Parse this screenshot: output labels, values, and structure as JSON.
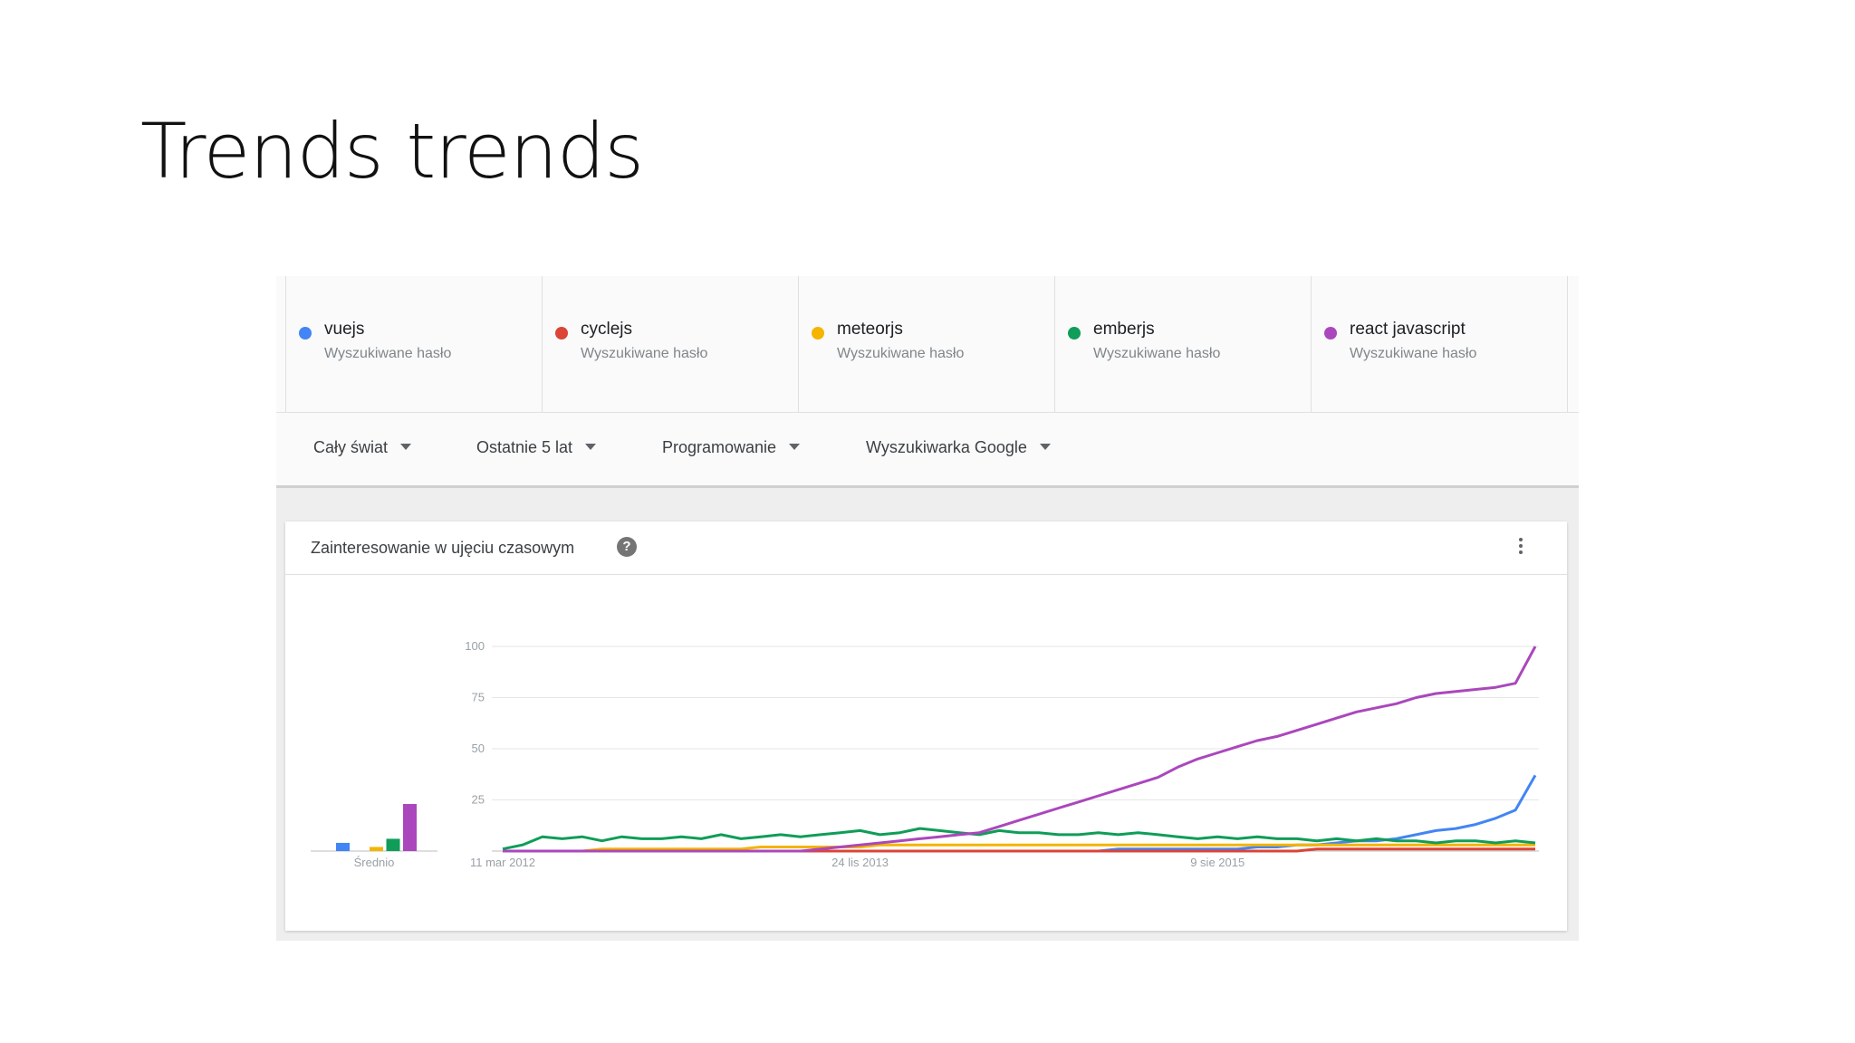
{
  "slide": {
    "title": "Trends trends"
  },
  "terms": [
    {
      "name": "vuejs",
      "sub": "Wyszukiwane hasło",
      "color": "#4285f4"
    },
    {
      "name": "cyclejs",
      "sub": "Wyszukiwane hasło",
      "color": "#db4437"
    },
    {
      "name": "meteorjs",
      "sub": "Wyszukiwane hasło",
      "color": "#f4b400"
    },
    {
      "name": "emberjs",
      "sub": "Wyszukiwane hasło",
      "color": "#0f9d58"
    },
    {
      "name": "react javascript",
      "sub": "Wyszukiwane hasło",
      "color": "#ab47bc"
    }
  ],
  "filters": [
    {
      "label": "Cały świat"
    },
    {
      "label": "Ostatnie 5 lat"
    },
    {
      "label": "Programowanie"
    },
    {
      "label": "Wyszukiwarka Google"
    }
  ],
  "card": {
    "title": "Zainteresowanie w ujęciu czasowym",
    "help_glyph": "?"
  },
  "chart_data": {
    "type": "line",
    "title": "Zainteresowanie w ujęciu czasowym",
    "y_ticks": [
      "100",
      "75",
      "50",
      "25"
    ],
    "ylim": [
      0,
      100
    ],
    "grid": true,
    "x_tick_labels": [
      "11 mar 2012",
      "24 lis 2013",
      "9 sie 2015"
    ],
    "x_tick_index": [
      0,
      18,
      36
    ],
    "x_points": 53,
    "average": {
      "label": "Średnio",
      "values": {
        "vuejs": 4,
        "cyclejs": 0,
        "meteorjs": 2,
        "emberjs": 6,
        "react javascript": 23
      }
    },
    "series": [
      {
        "name": "vuejs",
        "color": "#4285f4",
        "values": [
          0,
          0,
          0,
          0,
          0,
          0,
          0,
          0,
          0,
          0,
          0,
          0,
          0,
          0,
          0,
          0,
          0,
          0,
          0,
          0,
          0,
          0,
          0,
          0,
          0,
          0,
          0,
          0,
          0,
          0,
          0,
          1,
          1,
          1,
          1,
          1,
          1,
          1,
          2,
          2,
          3,
          3,
          4,
          5,
          5,
          6,
          8,
          10,
          11,
          13,
          16,
          20,
          37
        ]
      },
      {
        "name": "cyclejs",
        "color": "#db4437",
        "values": [
          0,
          0,
          0,
          0,
          0,
          0,
          0,
          0,
          0,
          0,
          0,
          0,
          0,
          0,
          0,
          0,
          0,
          0,
          0,
          0,
          0,
          0,
          0,
          0,
          0,
          0,
          0,
          0,
          0,
          0,
          0,
          0,
          0,
          0,
          0,
          0,
          0,
          0,
          0,
          0,
          0,
          1,
          1,
          1,
          1,
          1,
          1,
          1,
          1,
          1,
          1,
          1,
          1
        ]
      },
      {
        "name": "meteorjs",
        "color": "#f4b400",
        "values": [
          0,
          0,
          0,
          0,
          0,
          1,
          1,
          1,
          1,
          1,
          1,
          1,
          1,
          2,
          2,
          2,
          2,
          2,
          2,
          3,
          3,
          3,
          3,
          3,
          3,
          3,
          3,
          3,
          3,
          3,
          3,
          3,
          3,
          3,
          3,
          3,
          3,
          3,
          3,
          3,
          3,
          3,
          3,
          3,
          3,
          3,
          3,
          3,
          3,
          3,
          3,
          3,
          3
        ]
      },
      {
        "name": "emberjs",
        "color": "#0f9d58",
        "values": [
          1,
          3,
          7,
          6,
          7,
          5,
          7,
          6,
          6,
          7,
          6,
          8,
          6,
          7,
          8,
          7,
          8,
          9,
          10,
          8,
          9,
          11,
          10,
          9,
          8,
          10,
          9,
          9,
          8,
          8,
          9,
          8,
          9,
          8,
          7,
          6,
          7,
          6,
          7,
          6,
          6,
          5,
          6,
          5,
          6,
          5,
          5,
          4,
          5,
          5,
          4,
          5,
          4
        ]
      },
      {
        "name": "react javascript",
        "color": "#ab47bc",
        "values": [
          0,
          0,
          0,
          0,
          0,
          0,
          0,
          0,
          0,
          0,
          0,
          0,
          0,
          0,
          0,
          0,
          1,
          2,
          3,
          4,
          5,
          6,
          7,
          8,
          9,
          12,
          15,
          18,
          21,
          24,
          27,
          30,
          33,
          36,
          41,
          45,
          48,
          51,
          54,
          56,
          59,
          62,
          65,
          68,
          70,
          72,
          75,
          77,
          78,
          79,
          80,
          82,
          100
        ]
      }
    ]
  }
}
